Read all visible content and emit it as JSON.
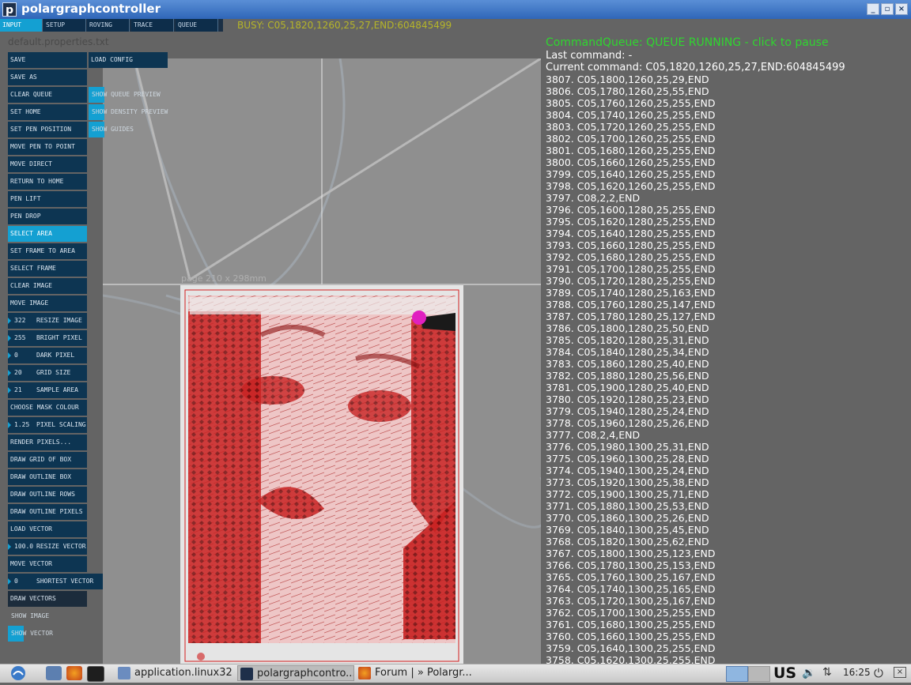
{
  "window": {
    "title": "polargraphcontroller",
    "icon_letter": "p"
  },
  "tabs": [
    {
      "label": "INPUT",
      "active": true
    },
    {
      "label": "SETUP",
      "active": false
    },
    {
      "label": "ROVING",
      "active": false
    },
    {
      "label": "TRACE",
      "active": false
    },
    {
      "label": "QUEUE",
      "active": false
    }
  ],
  "status": {
    "busy": "BUSY: C05,1820,1260,25,27,END:604845499",
    "properties_file": "default.properties.txt"
  },
  "controls": {
    "save": "SAVE",
    "load_config": "LOAD CONFIG",
    "save_as": "SAVE AS",
    "clear_queue": "CLEAR QUEUE",
    "show_queue_preview": "SHOW QUEUE PREVIEW",
    "set_home": "SET HOME",
    "show_density_preview": "SHOW DENSITY PREVIEW",
    "set_pen_position": "SET PEN POSITION",
    "show_guides": "SHOW GUIDES",
    "move_pen_to_point": "MOVE PEN TO POINT",
    "move_direct": "MOVE DIRECT",
    "return_to_home": "RETURN TO HOME",
    "pen_lift": "PEN LIFT",
    "pen_drop": "PEN DROP",
    "select_area": "SELECT AREA",
    "set_frame_to_area": "SET FRAME TO AREA",
    "select_frame": "SELECT FRAME",
    "clear_image": "CLEAR IMAGE",
    "move_image": "MOVE IMAGE",
    "resize_image_val": "322",
    "resize_image": "RESIZE IMAGE",
    "bright_pixel_val": "255",
    "bright_pixel": "BRIGHT PIXEL",
    "dark_pixel_val": "0",
    "dark_pixel": "DARK PIXEL",
    "grid_size_val": "20",
    "grid_size": "GRID SIZE",
    "sample_area_val": "21",
    "sample_area": "SAMPLE AREA",
    "choose_mask_colour": "CHOOSE MASK COLOUR",
    "pixel_scaling_val": "1.25",
    "pixel_scaling": "PIXEL SCALING",
    "render_pixels": "RENDER PIXELS...",
    "draw_grid_of_box": "DRAW GRID OF BOX",
    "draw_outline_box": "DRAW OUTLINE BOX",
    "draw_outline_rows": "DRAW OUTLINE ROWS",
    "draw_outline_pixels": "DRAW OUTLINE PIXELS",
    "load_vector": "LOAD VECTOR",
    "resize_vector_val": "100.0",
    "resize_vector": "RESIZE VECTOR",
    "move_vector": "MOVE VECTOR",
    "shortest_vector_val": "0",
    "shortest_vector": "SHORTEST VECTOR",
    "draw_vectors": "DRAW VECTORS",
    "show_image": "SHOW IMAGE",
    "show_vector": "SHOW VECTOR"
  },
  "canvas": {
    "page_label": "page 210 x 298mm"
  },
  "queue": {
    "status": "CommandQueue: QUEUE RUNNING - click to pause",
    "last_command": "Last command: -",
    "current_command": "Current command: C05,1820,1260,25,27,END:604845499",
    "commands": [
      "3807. C05,1800,1260,25,29,END",
      "3806. C05,1780,1260,25,55,END",
      "3805. C05,1760,1260,25,255,END",
      "3804. C05,1740,1260,25,255,END",
      "3803. C05,1720,1260,25,255,END",
      "3802. C05,1700,1260,25,255,END",
      "3801. C05,1680,1260,25,255,END",
      "3800. C05,1660,1260,25,255,END",
      "3799. C05,1640,1260,25,255,END",
      "3798. C05,1620,1260,25,255,END",
      "3797. C08,2,2,END",
      "3796. C05,1600,1280,25,255,END",
      "3795. C05,1620,1280,25,255,END",
      "3794. C05,1640,1280,25,255,END",
      "3793. C05,1660,1280,25,255,END",
      "3792. C05,1680,1280,25,255,END",
      "3791. C05,1700,1280,25,255,END",
      "3790. C05,1720,1280,25,255,END",
      "3789. C05,1740,1280,25,163,END",
      "3788. C05,1760,1280,25,147,END",
      "3787. C05,1780,1280,25,127,END",
      "3786. C05,1800,1280,25,50,END",
      "3785. C05,1820,1280,25,31,END",
      "3784. C05,1840,1280,25,34,END",
      "3783. C05,1860,1280,25,40,END",
      "3782. C05,1880,1280,25,56,END",
      "3781. C05,1900,1280,25,40,END",
      "3780. C05,1920,1280,25,23,END",
      "3779. C05,1940,1280,25,24,END",
      "3778. C05,1960,1280,25,26,END",
      "3777. C08,2,4,END",
      "3776. C05,1980,1300,25,31,END",
      "3775. C05,1960,1300,25,28,END",
      "3774. C05,1940,1300,25,24,END",
      "3773. C05,1920,1300,25,38,END",
      "3772. C05,1900,1300,25,71,END",
      "3771. C05,1880,1300,25,53,END",
      "3770. C05,1860,1300,25,26,END",
      "3769. C05,1840,1300,25,45,END",
      "3768. C05,1820,1300,25,62,END",
      "3767. C05,1800,1300,25,123,END",
      "3766. C05,1780,1300,25,153,END",
      "3765. C05,1760,1300,25,167,END",
      "3764. C05,1740,1300,25,165,END",
      "3763. C05,1720,1300,25,167,END",
      "3762. C05,1700,1300,25,255,END",
      "3761. C05,1680,1300,25,255,END",
      "3760. C05,1660,1300,25,255,END",
      "3759. C05,1640,1300,25,255,END",
      "3758. C05,1620,1300,25,255,END"
    ]
  },
  "taskbar": {
    "tasks": [
      "application.linux32",
      "polargraphcontro...",
      "Forum | » Polargr..."
    ],
    "keyboard": "US",
    "clock": "16:25"
  },
  "colors": {
    "accent": "#14a0d2",
    "button_bg": "#0d3552",
    "queue_running": "#2fd62f",
    "busy_text": "#b5b529",
    "drawing_red": "#d42020"
  }
}
